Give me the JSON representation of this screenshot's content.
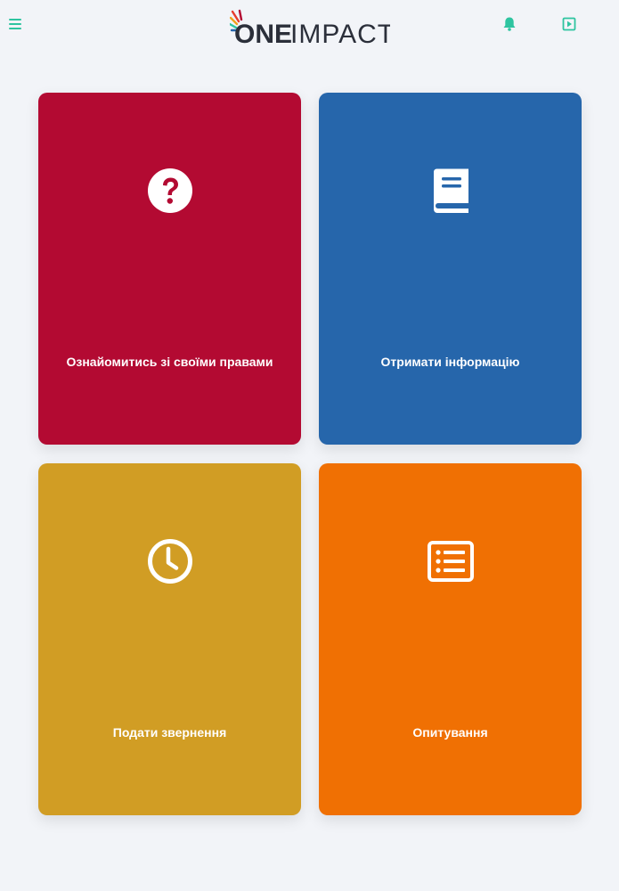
{
  "header": {
    "logo_text_bold": "ONE",
    "logo_text_light": "IMPACT",
    "accent_color": "#2ec4a0"
  },
  "tiles": [
    {
      "label": "Ознайомитись зі своїми правами",
      "icon": "question-circle-icon",
      "color": "#b30a32"
    },
    {
      "label": "Отримати інформацію",
      "icon": "book-icon",
      "color": "#2666ab"
    },
    {
      "label": "Подати звернення",
      "icon": "clock-icon",
      "color": "#d19d24"
    },
    {
      "label": "Опитування",
      "icon": "list-icon",
      "color": "#f07003"
    }
  ]
}
